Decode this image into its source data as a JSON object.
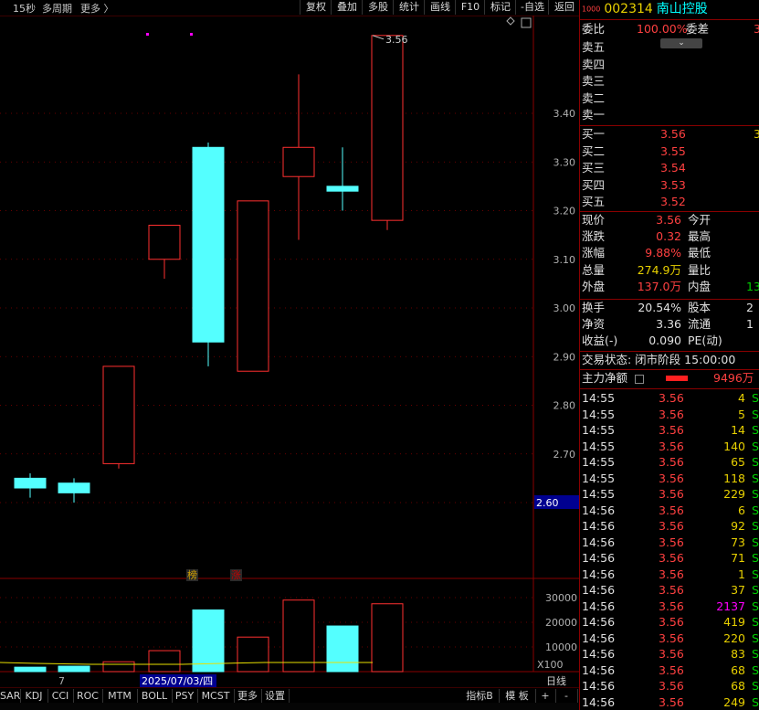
{
  "toolbar": {
    "left_items": [
      "15秒",
      "多周期",
      "更多 〉"
    ],
    "buttons": [
      "复权",
      "叠加",
      "多股",
      "统计",
      "画线",
      "F10",
      "标记",
      "-自选",
      "返回"
    ]
  },
  "chart_data": {
    "type": "candlestick",
    "y_ticks": [
      "3.40",
      "3.30",
      "3.20",
      "3.10",
      "3.00",
      "2.90",
      "2.80",
      "2.70",
      "2.60"
    ],
    "current_price_label": "2.60",
    "high_marker": "3.56",
    "candles": [
      {
        "open": 2.63,
        "close": 2.65,
        "high": 2.66,
        "low": 2.61,
        "dir": "down"
      },
      {
        "open": 2.64,
        "close": 2.62,
        "high": 2.65,
        "low": 2.6,
        "dir": "down"
      },
      {
        "open": 2.68,
        "close": 2.88,
        "high": 2.88,
        "low": 2.67,
        "dir": "up"
      },
      {
        "open": 3.1,
        "close": 3.17,
        "high": 3.17,
        "low": 3.06,
        "dir": "up"
      },
      {
        "open": 3.33,
        "close": 2.93,
        "high": 3.34,
        "low": 2.88,
        "dir": "down"
      },
      {
        "open": 2.87,
        "close": 3.22,
        "high": 3.22,
        "low": 2.87,
        "dir": "up"
      },
      {
        "open": 3.27,
        "close": 3.33,
        "high": 3.48,
        "low": 3.14,
        "dir": "up"
      },
      {
        "open": 3.25,
        "close": 3.24,
        "high": 3.33,
        "low": 3.2,
        "dir": "down"
      },
      {
        "open": 3.18,
        "close": 3.56,
        "high": 3.56,
        "low": 3.16,
        "dir": "up"
      }
    ],
    "volume_ticks": [
      "30000",
      "20000",
      "10000"
    ],
    "volume_unit": "X100",
    "volumes": [
      {
        "value": 1800,
        "dir": "down"
      },
      {
        "value": 2200,
        "dir": "down"
      },
      {
        "value": 4000,
        "dir": "up"
      },
      {
        "value": 8500,
        "dir": "up"
      },
      {
        "value": 25000,
        "dir": "down"
      },
      {
        "value": 14000,
        "dir": "up"
      },
      {
        "value": 29000,
        "dir": "up"
      },
      {
        "value": 18500,
        "dir": "down"
      },
      {
        "value": 27500,
        "dir": "up"
      }
    ],
    "badges": [
      "榜",
      "涨"
    ],
    "date_label": "2025/07/03/四",
    "x_label": "7"
  },
  "indicator_tabs": [
    "SAR",
    "KDJ",
    "CCI",
    "ROC",
    "MTM",
    "BOLL",
    "PSY",
    "MCST",
    "更多",
    "设置"
  ],
  "right_tabs": [
    "指标B",
    "模 板",
    "+",
    "-"
  ],
  "period_label": "日线",
  "stock": {
    "code": "002314",
    "name": "南山控股",
    "badge": "1000"
  },
  "order_book": {
    "wei_bi_label": "委比",
    "wei_bi": "100.00%",
    "wei_cha_label": "委差",
    "wei_cha": "3",
    "sells": [
      "卖五",
      "卖四",
      "卖三",
      "卖二",
      "卖一"
    ],
    "buys": [
      {
        "label": "买一",
        "price": "3.56",
        "vol": "3"
      },
      {
        "label": "买二",
        "price": "3.55",
        "vol": ""
      },
      {
        "label": "买三",
        "price": "3.54",
        "vol": ""
      },
      {
        "label": "买四",
        "price": "3.53",
        "vol": ""
      },
      {
        "label": "买五",
        "price": "3.52",
        "vol": ""
      }
    ]
  },
  "quote": [
    {
      "l": "现价",
      "v": "3.56",
      "vc": "c-red",
      "r": "今开"
    },
    {
      "l": "涨跌",
      "v": "0.32",
      "vc": "c-red",
      "r": "最高"
    },
    {
      "l": "涨幅",
      "v": "9.88%",
      "vc": "c-red",
      "r": "最低"
    },
    {
      "l": "总量",
      "v": "274.9万",
      "vc": "c-yellow",
      "r": "量比"
    },
    {
      "l": "外盘",
      "v": "137.0万",
      "vc": "c-red",
      "r": "内盘",
      "extra": "13",
      "ec": "c-green"
    },
    {
      "l": "换手",
      "v": "20.54%",
      "vc": "c-white",
      "r": "股本",
      "extra": "2",
      "ec": "c-white"
    },
    {
      "l": "净资",
      "v": "3.36",
      "vc": "c-white",
      "r": "流通",
      "extra": "1",
      "ec": "c-white"
    },
    {
      "l": "收益(-)",
      "v": "0.090",
      "vc": "c-white",
      "r": "PE(动)"
    }
  ],
  "trade_status": "交易状态: 闭市阶段 15:00:00",
  "main_flow_label": "主力净额",
  "main_flow": "9496万",
  "ticks": [
    {
      "t": "14:55",
      "p": "3.56",
      "v": "4",
      "f": "S"
    },
    {
      "t": "14:55",
      "p": "3.56",
      "v": "5",
      "f": "S"
    },
    {
      "t": "14:55",
      "p": "3.56",
      "v": "14",
      "f": "S"
    },
    {
      "t": "14:55",
      "p": "3.56",
      "v": "140",
      "f": "S"
    },
    {
      "t": "14:55",
      "p": "3.56",
      "v": "65",
      "f": "S"
    },
    {
      "t": "14:55",
      "p": "3.56",
      "v": "118",
      "f": "S"
    },
    {
      "t": "14:55",
      "p": "3.56",
      "v": "229",
      "f": "S"
    },
    {
      "t": "14:56",
      "p": "3.56",
      "v": "6",
      "f": "S"
    },
    {
      "t": "14:56",
      "p": "3.56",
      "v": "92",
      "f": "S"
    },
    {
      "t": "14:56",
      "p": "3.56",
      "v": "73",
      "f": "S"
    },
    {
      "t": "14:56",
      "p": "3.56",
      "v": "71",
      "f": "S"
    },
    {
      "t": "14:56",
      "p": "3.56",
      "v": "1",
      "f": "S"
    },
    {
      "t": "14:56",
      "p": "3.56",
      "v": "37",
      "f": "S"
    },
    {
      "t": "14:56",
      "p": "3.56",
      "v": "2137",
      "f": "S",
      "vc": "c-mag"
    },
    {
      "t": "14:56",
      "p": "3.56",
      "v": "419",
      "f": "S"
    },
    {
      "t": "14:56",
      "p": "3.56",
      "v": "220",
      "f": "S"
    },
    {
      "t": "14:56",
      "p": "3.56",
      "v": "83",
      "f": "S"
    },
    {
      "t": "14:56",
      "p": "3.56",
      "v": "68",
      "f": "S"
    },
    {
      "t": "14:56",
      "p": "3.56",
      "v": "68",
      "f": "S"
    },
    {
      "t": "14:56",
      "p": "3.56",
      "v": "249",
      "f": "S"
    }
  ],
  "colors": {
    "up": "#ff3030",
    "down": "#54ffff",
    "bg": "#000000",
    "grid": "#8a0000"
  }
}
